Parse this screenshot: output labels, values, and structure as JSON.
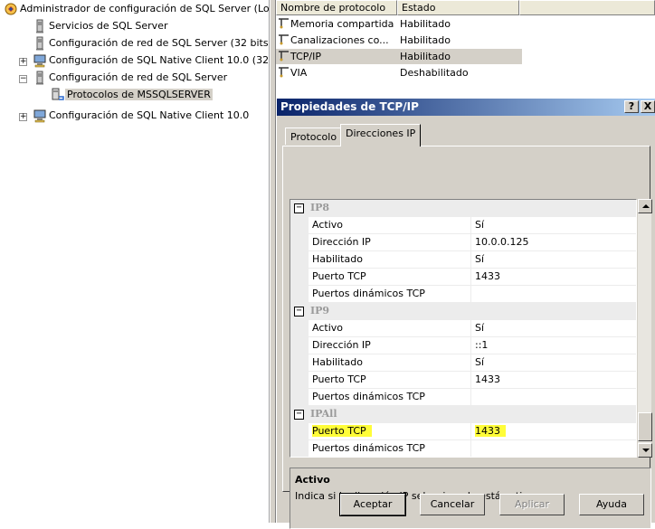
{
  "tree": {
    "items": [
      {
        "label": "Administrador de configuración de SQL Server (Lo"
      },
      {
        "label": "Servicios de SQL Server"
      },
      {
        "label": "Configuración de red de SQL Server (32 bits)"
      },
      {
        "label": "Configuración de SQL Native Client 10.0 (32 b"
      },
      {
        "label": "Configuración de red de SQL Server"
      },
      {
        "label": "Protocolos de MSSQLSERVER"
      },
      {
        "label": "Configuración de SQL Native Client 10.0"
      }
    ],
    "expand_plus": "+",
    "expand_minus": "−"
  },
  "list": {
    "headers": {
      "name": "Nombre de protocolo",
      "state": "Estado"
    },
    "rows": [
      {
        "name": "Memoria compartida",
        "state": "Habilitado"
      },
      {
        "name": "Canalizaciones co...",
        "state": "Habilitado"
      },
      {
        "name": "TCP/IP",
        "state": "Habilitado"
      },
      {
        "name": "VIA",
        "state": "Deshabilitado"
      }
    ]
  },
  "dialog": {
    "title": "Propiedades de TCP/IP",
    "help_btn": "?",
    "close_btn": "X",
    "tabs": [
      "Protocolo",
      "Direcciones IP"
    ],
    "categories": [
      {
        "name": "IP8",
        "rows": [
          {
            "name": "Activo",
            "value": "Sí"
          },
          {
            "name": "Dirección IP",
            "value": "10.0.0.125"
          },
          {
            "name": "Habilitado",
            "value": "Sí"
          },
          {
            "name": "Puerto TCP",
            "value": "1433"
          },
          {
            "name": "Puertos dinámicos TCP",
            "value": ""
          }
        ]
      },
      {
        "name": "IP9",
        "rows": [
          {
            "name": "Activo",
            "value": "Sí"
          },
          {
            "name": "Dirección IP",
            "value": "::1"
          },
          {
            "name": "Habilitado",
            "value": "Sí"
          },
          {
            "name": "Puerto TCP",
            "value": "1433"
          },
          {
            "name": "Puertos dinámicos TCP",
            "value": ""
          }
        ]
      },
      {
        "name": "IPAll",
        "rows": [
          {
            "name": "Puerto TCP",
            "value": "1433"
          },
          {
            "name": "Puertos dinámicos TCP",
            "value": ""
          }
        ]
      }
    ],
    "collapse_glyph": "−",
    "description": {
      "title": "Activo",
      "text": "Indica si la dirección IP seleccionada está activa."
    },
    "buttons": {
      "ok": "Aceptar",
      "cancel": "Cancelar",
      "apply": "Aplicar",
      "help": "Ayuda"
    },
    "highlight_color": "#fffd38"
  }
}
